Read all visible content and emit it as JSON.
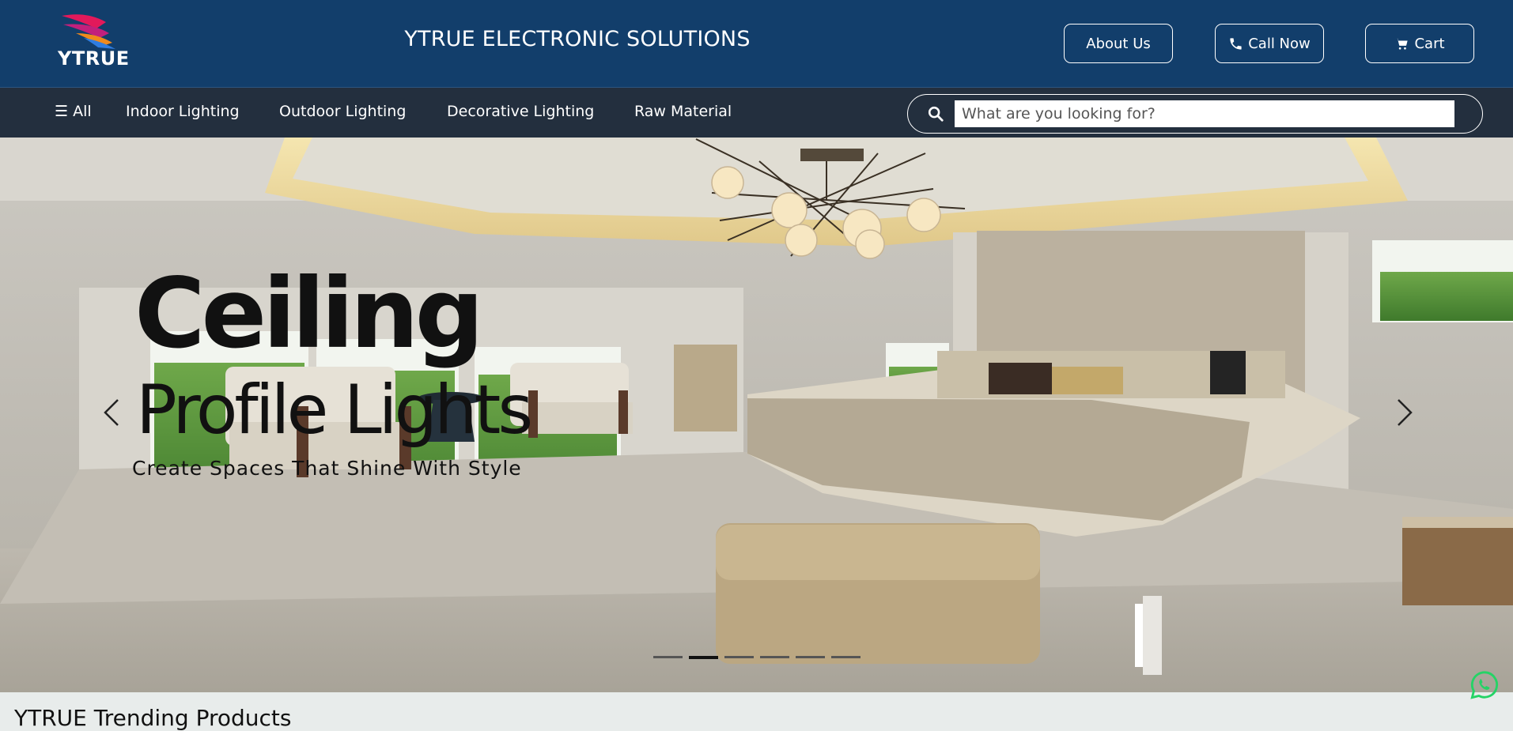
{
  "header": {
    "logo_text": "YTRUE",
    "site_title": "YTRUE ELECTRONIC SOLUTIONS",
    "about_label": "About Us",
    "call_label": "Call Now",
    "cart_label": "Cart"
  },
  "nav": {
    "all_label": "☰ All",
    "items": [
      "Indoor Lighting",
      "Outdoor Lighting",
      "Decorative Lighting",
      "Raw Material"
    ]
  },
  "search": {
    "placeholder": "What are you looking for?"
  },
  "hero": {
    "title_line1": "Ceiling",
    "title_line2": "Profile Lights",
    "tagline": "Create Spaces That Shine With Style",
    "slide_count": 6,
    "active_slide": 2
  },
  "section": {
    "trending_title": "YTRUE Trending Products"
  },
  "colors": {
    "header_bg": "#123e6b",
    "nav_bg": "#232f3e",
    "whatsapp": "#25d366"
  },
  "icons": [
    "logo-icon",
    "phone-icon",
    "cart-icon",
    "search-icon",
    "chevron-left-icon",
    "chevron-right-icon",
    "whatsapp-icon"
  ]
}
